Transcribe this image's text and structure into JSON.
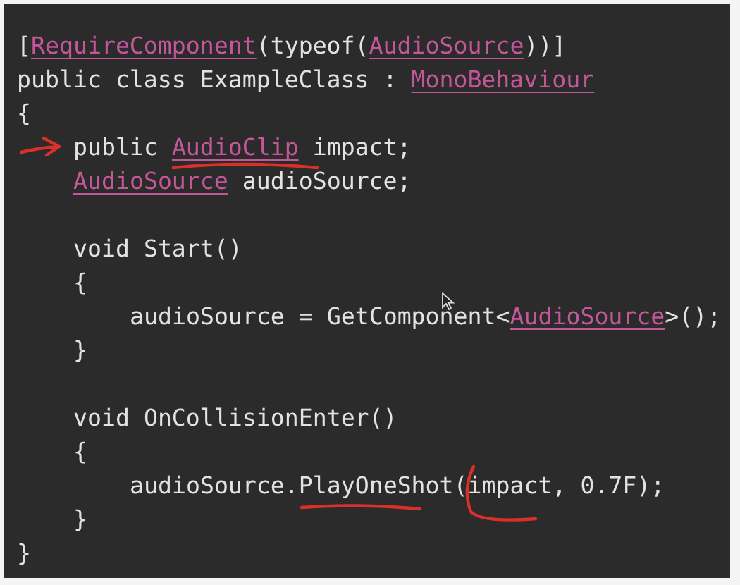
{
  "editor": {
    "lines": [
      {
        "kind": "code",
        "tokens": [
          {
            "kind": "plain",
            "text": "["
          },
          {
            "kind": "type",
            "text": "RequireComponent"
          },
          {
            "kind": "plain",
            "text": "(typeof("
          },
          {
            "kind": "type",
            "text": "AudioSource"
          },
          {
            "kind": "plain",
            "text": "))]"
          }
        ]
      },
      {
        "kind": "code",
        "tokens": [
          {
            "kind": "plain",
            "text": "public class ExampleClass : "
          },
          {
            "kind": "type",
            "text": "MonoBehaviour"
          }
        ]
      },
      {
        "kind": "code",
        "tokens": [
          {
            "kind": "plain",
            "text": "{"
          }
        ],
        "children": [
          {
            "kind": "code",
            "tokens": [
              {
                "kind": "plain",
                "text": "public "
              },
              {
                "kind": "type",
                "text": "AudioClip"
              },
              {
                "kind": "plain",
                "text": " impact;"
              }
            ]
          },
          {
            "kind": "code",
            "tokens": [
              {
                "kind": "type",
                "text": "AudioSource"
              },
              {
                "kind": "plain",
                "text": " audioSource;"
              }
            ]
          },
          {
            "kind": "blank"
          },
          {
            "kind": "code",
            "tokens": [
              {
                "kind": "plain",
                "text": "void Start()"
              }
            ]
          },
          {
            "kind": "code",
            "tokens": [
              {
                "kind": "plain",
                "text": "{"
              }
            ],
            "children": [
              {
                "kind": "code",
                "tokens": [
                  {
                    "kind": "plain",
                    "text": "audioSource = GetComponent<"
                  },
                  {
                    "kind": "type",
                    "text": "AudioSource"
                  },
                  {
                    "kind": "plain",
                    "text": ">();"
                  }
                ]
              }
            ]
          },
          {
            "kind": "code",
            "tokens": [
              {
                "kind": "plain",
                "text": "}"
              }
            ]
          },
          {
            "kind": "blank"
          },
          {
            "kind": "code",
            "tokens": [
              {
                "kind": "plain",
                "text": "void OnCollisionEnter()"
              }
            ]
          },
          {
            "kind": "code",
            "tokens": [
              {
                "kind": "plain",
                "text": "{"
              }
            ],
            "children": [
              {
                "kind": "code",
                "tokens": [
                  {
                    "kind": "plain",
                    "text": "audioSource.PlayOneShot(impact, 0.7F);"
                  }
                ]
              }
            ]
          },
          {
            "kind": "code",
            "tokens": [
              {
                "kind": "plain",
                "text": "}"
              }
            ]
          }
        ]
      },
      {
        "kind": "code",
        "tokens": [
          {
            "kind": "plain",
            "text": "}"
          }
        ]
      }
    ]
  }
}
